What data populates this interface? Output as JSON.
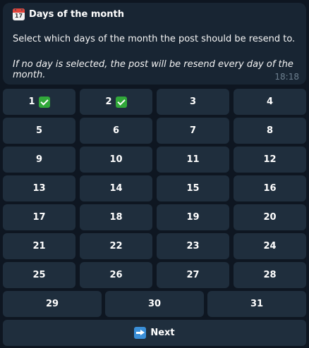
{
  "message": {
    "icon": "calendar-icon",
    "calendar_day": "17",
    "title": "Days of the month",
    "line1": "Select which days of the month the post should be resend to.",
    "line2": "If no day is selected, the post will be resend every day of the month.",
    "time": "18:18"
  },
  "keyboard": {
    "days": [
      {
        "label": "1",
        "selected": true
      },
      {
        "label": "2",
        "selected": true
      },
      {
        "label": "3",
        "selected": false
      },
      {
        "label": "4",
        "selected": false
      },
      {
        "label": "5",
        "selected": false
      },
      {
        "label": "6",
        "selected": false
      },
      {
        "label": "7",
        "selected": false
      },
      {
        "label": "8",
        "selected": false
      },
      {
        "label": "9",
        "selected": false
      },
      {
        "label": "10",
        "selected": false
      },
      {
        "label": "11",
        "selected": false
      },
      {
        "label": "12",
        "selected": false
      },
      {
        "label": "13",
        "selected": false
      },
      {
        "label": "14",
        "selected": false
      },
      {
        "label": "15",
        "selected": false
      },
      {
        "label": "16",
        "selected": false
      },
      {
        "label": "17",
        "selected": false
      },
      {
        "label": "18",
        "selected": false
      },
      {
        "label": "19",
        "selected": false
      },
      {
        "label": "20",
        "selected": false
      },
      {
        "label": "21",
        "selected": false
      },
      {
        "label": "22",
        "selected": false
      },
      {
        "label": "23",
        "selected": false
      },
      {
        "label": "24",
        "selected": false
      },
      {
        "label": "25",
        "selected": false
      },
      {
        "label": "26",
        "selected": false
      },
      {
        "label": "27",
        "selected": false
      },
      {
        "label": "28",
        "selected": false
      },
      {
        "label": "29",
        "selected": false
      },
      {
        "label": "30",
        "selected": false
      },
      {
        "label": "31",
        "selected": false
      }
    ],
    "selected_icon": "check-mark-icon",
    "next_label": "Next",
    "next_icon": "right-arrow-icon"
  }
}
